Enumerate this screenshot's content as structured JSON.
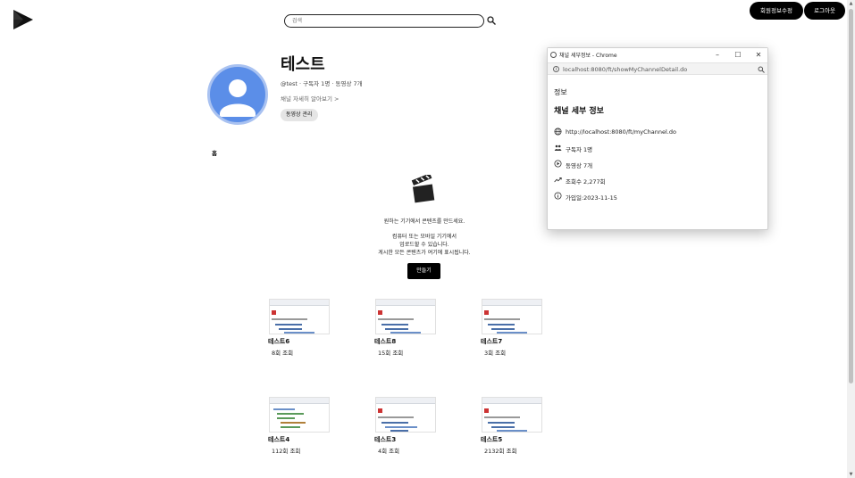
{
  "header": {
    "search_placeholder": "검색",
    "edit_profile_label": "회원정보수정",
    "logout_label": "로그아웃"
  },
  "channel": {
    "name": "테스트",
    "meta": "@test · 구독자 1명 · 동영상 7개",
    "more_info": "채널 자세히 알아보기 >",
    "manage_videos_label": "동영상 관리",
    "home_tab": "홈"
  },
  "empty_state": {
    "line1": "원하는 기기에서 콘텐츠를 만드세요.",
    "line2": "컴퓨터 또는 모바일 기기에서",
    "line3": "업로드할 수 있습니다.",
    "line4": "게시한 모든 콘텐츠가 여기에 표시됩니다.",
    "create_label": "만들기"
  },
  "videos": [
    {
      "title": "테스트6",
      "views": "8회 조회"
    },
    {
      "title": "테스트8",
      "views": "15회 조회"
    },
    {
      "title": "테스트7",
      "views": "3회 조회"
    },
    {
      "title": "테스트4",
      "views": "112회 조회"
    },
    {
      "title": "테스트3",
      "views": "4회 조회"
    },
    {
      "title": "테스트5",
      "views": "2132회 조회"
    }
  ],
  "popup": {
    "window_title": "채널 세부정보 - Chrome",
    "url": "localhost:8080/ft/showMyChannelDetail.do",
    "heading": "정보",
    "subheading": "채널 세부 정보",
    "channel_url": "http://localhost:8080/ft/myChannel.do",
    "subscribers": "구독자 1명",
    "videos_count": "동영상 7개",
    "views": "조회수 2,277회",
    "joined": "가입일:2023-11-15"
  },
  "colors": {
    "avatar_bg": "#5b8ee8",
    "avatar_ring": "#a9c2f1",
    "button_bg": "#000000"
  }
}
